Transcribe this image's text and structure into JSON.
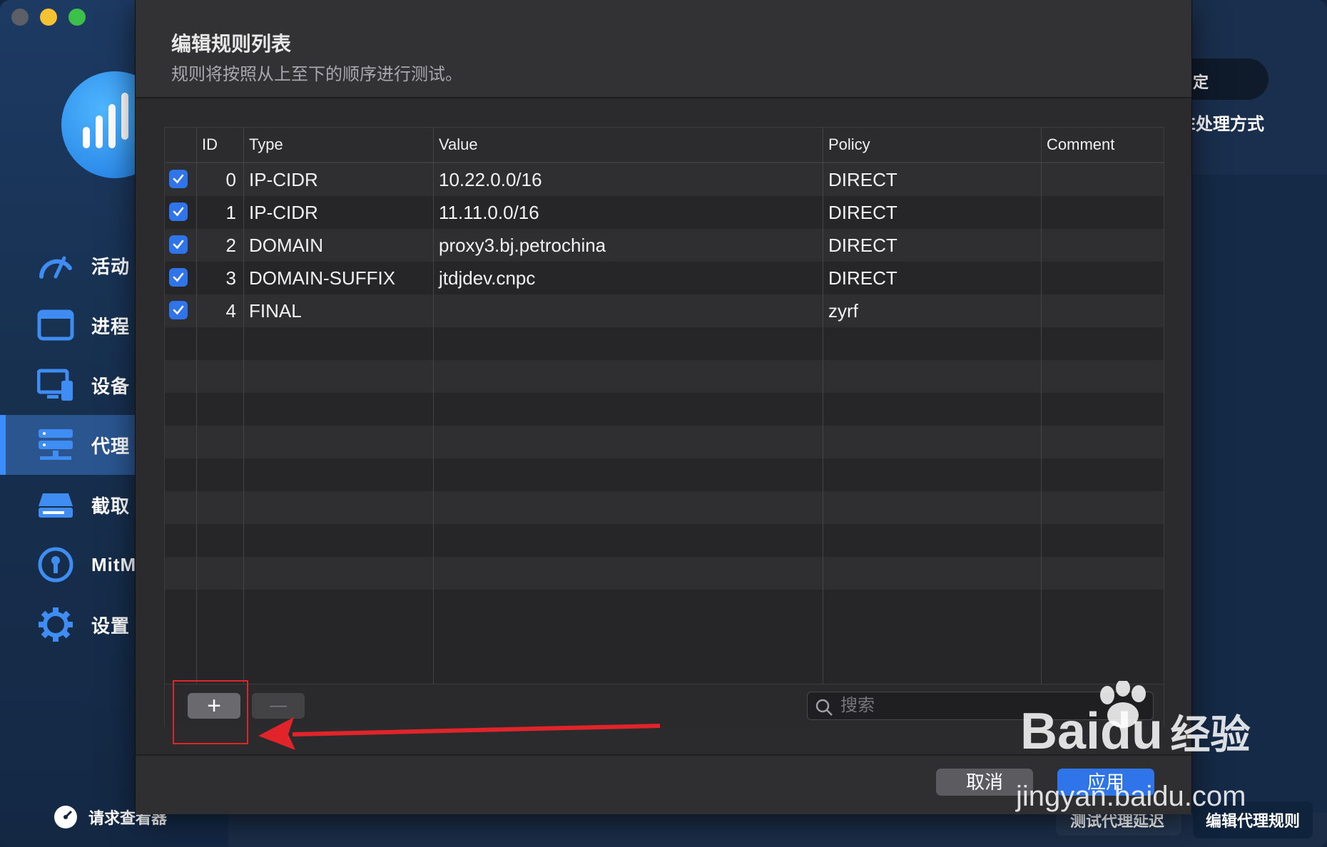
{
  "sidebar": {
    "items": [
      {
        "label": "活动",
        "icon": "speedometer-icon"
      },
      {
        "label": "进程",
        "icon": "window-icon"
      },
      {
        "label": "设备",
        "icon": "devices-icon"
      },
      {
        "label": "代理",
        "icon": "server-stack-icon"
      },
      {
        "label": "截取",
        "icon": "drive-icon"
      },
      {
        "label": "MitM",
        "icon": "keyhole-icon"
      },
      {
        "label": "设置",
        "icon": "gear-icon"
      }
    ],
    "bottom_label": "请求查看器"
  },
  "background_app": {
    "top_right_button": "定",
    "top_right_text": "E处理方式",
    "bottom_buttons": [
      "测试代理延迟",
      "编辑代理规则"
    ]
  },
  "dialog": {
    "title": "编辑规则列表",
    "subtitle": "规则将按照从上至下的顺序进行测试。",
    "columns": [
      "ID",
      "Type",
      "Value",
      "Policy",
      "Comment"
    ],
    "rows": [
      {
        "checked": true,
        "id": "0",
        "type": "IP-CIDR",
        "value": "10.22.0.0/16",
        "policy": "DIRECT",
        "comment": ""
      },
      {
        "checked": true,
        "id": "1",
        "type": "IP-CIDR",
        "value": "11.11.0.0/16",
        "policy": "DIRECT",
        "comment": ""
      },
      {
        "checked": true,
        "id": "2",
        "type": "DOMAIN",
        "value": "proxy3.bj.petrochina",
        "policy": "DIRECT",
        "comment": ""
      },
      {
        "checked": true,
        "id": "3",
        "type": "DOMAIN-SUFFIX",
        "value": "jtdjdev.cnpc",
        "policy": "DIRECT",
        "comment": ""
      },
      {
        "checked": true,
        "id": "4",
        "type": "FINAL",
        "value": "",
        "policy": "zyrf",
        "comment": ""
      }
    ],
    "add_label": "+",
    "remove_label": "—",
    "search_placeholder": "搜索",
    "cancel_label": "取消",
    "apply_label": "应用"
  },
  "watermark": {
    "brand": "Baidu",
    "suffix": "经验",
    "url": "jingyan.baidu.com"
  },
  "colors": {
    "accent": "#2f74e8",
    "annotation": "#e0242a",
    "sidebar_active": "#2a558f"
  }
}
